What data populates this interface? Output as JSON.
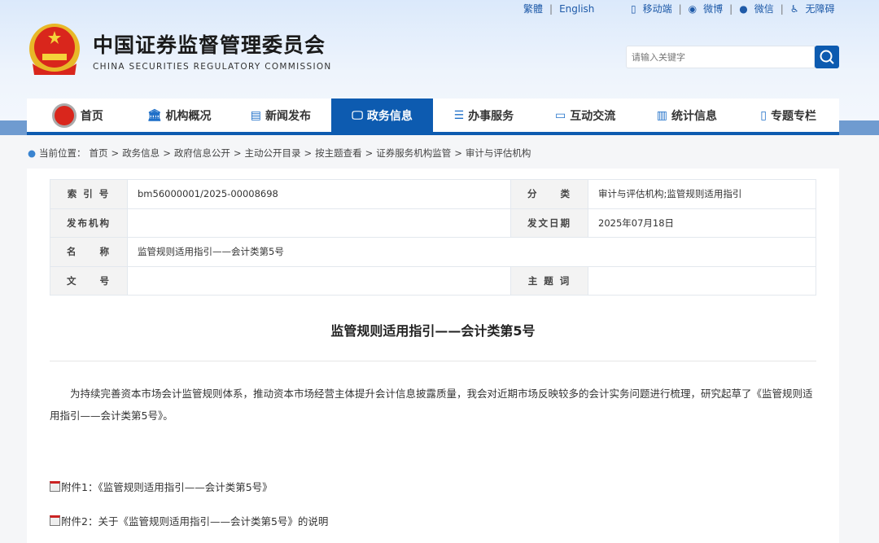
{
  "header": {
    "top_links": [
      "繁體",
      "English"
    ],
    "social_links": [
      "移动端",
      "微博",
      "微信",
      "无障碍"
    ],
    "title_cn": "中国证券监督管理委员会",
    "title_en": "CHINA SECURITIES REGULATORY COMMISSION",
    "search_placeholder": "请输入关键字"
  },
  "nav": [
    {
      "label": "首页"
    },
    {
      "label": "机构概况"
    },
    {
      "label": "新闻发布"
    },
    {
      "label": "政务信息",
      "active": true
    },
    {
      "label": "办事服务"
    },
    {
      "label": "互动交流"
    },
    {
      "label": "统计信息"
    },
    {
      "label": "专题专栏"
    }
  ],
  "breadcrumb": {
    "prefix": "当前位置：",
    "items": [
      "首页",
      "政务信息",
      "政府信息公开",
      "主动公开目录",
      "按主题查看",
      "证券服务机构监管",
      "审计与评估机构"
    ]
  },
  "info": {
    "index_label": "索 引 号",
    "index_value": "bm56000001/2025-00008698",
    "category_label": "分　　类",
    "category_value": "审计与评估机构;监管规则适用指引",
    "publisher_label": "发布机构",
    "publisher_value": "",
    "date_label": "发文日期",
    "date_value": "2025年07月18日",
    "name_label": "名　　称",
    "name_value": "监管规则适用指引——会计类第5号",
    "docno_label": "文　　号",
    "docno_value": "",
    "keywords_label": "主 题 词",
    "keywords_value": ""
  },
  "article": {
    "title": "监管规则适用指引——会计类第5号",
    "body": "为持续完善资本市场会计监管规则体系，推动资本市场经营主体提升会计信息披露质量，我会对近期市场反映较多的会计实务问题进行梳理，研究起草了《监管规则适用指引——会计类第5号》。",
    "attachments": [
      "附件1：《监管规则适用指引——会计类第5号》",
      "附件2：关于《监管规则适用指引——会计类第5号》的说明"
    ]
  }
}
